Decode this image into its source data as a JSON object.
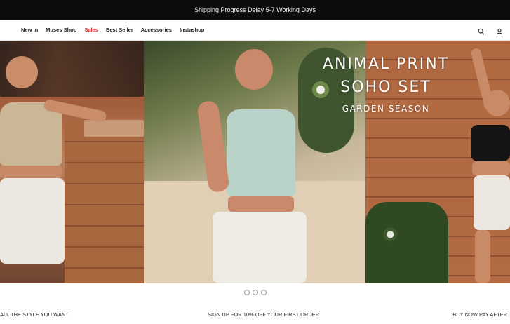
{
  "announcement": {
    "text": "Shipping Progress Delay 5-7 Working Days"
  },
  "nav": {
    "items": [
      {
        "label": "New In"
      },
      {
        "label": "Muses Shop"
      },
      {
        "label": "Sales"
      },
      {
        "label": "Best Seller"
      },
      {
        "label": "Accessories"
      },
      {
        "label": "Instashop"
      }
    ],
    "icons": [
      "search-icon",
      "account-icon"
    ]
  },
  "hero": {
    "headline_line1": "ANIMAL PRINT",
    "headline_line2": "SOHO SET",
    "subheadline": "GARDEN SEASON",
    "slides_count": 3,
    "active_slide": 1
  },
  "footer_strip": {
    "left": "ALL THE STYLE YOU WANT",
    "middle": "SIGN UP FOR 10% OFF YOUR FIRST ORDER",
    "right": "BUY NOW PAY AFTER"
  },
  "colors": {
    "announcement_bg": "#0d0d0d",
    "sale_red": "#d8262a",
    "text_dark": "#1f1f1f"
  }
}
